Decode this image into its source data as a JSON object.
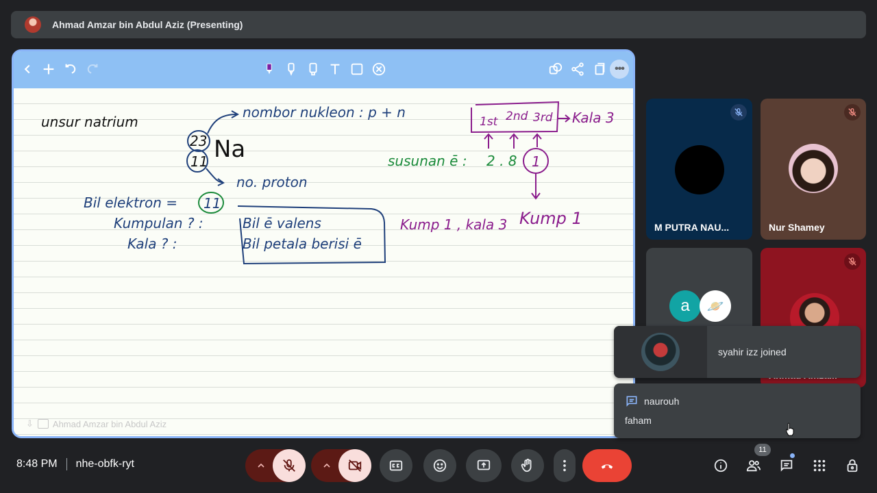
{
  "presenting_bar": {
    "title": "Ahmad Amzar bin Abdul Aziz (Presenting)"
  },
  "jamboard": {
    "toolbar_left": [
      "back-icon",
      "add-icon",
      "undo-icon",
      "redo-icon"
    ],
    "toolbar_center": [
      "pen-icon",
      "marker-icon",
      "highlighter-icon",
      "text-icon",
      "shape-icon",
      "eraser-icon"
    ],
    "toolbar_right": [
      "copy-icon",
      "share-icon",
      "pages-icon",
      "more-icon"
    ],
    "watermark": "Ahmad Amzar bin Abdul Aziz"
  },
  "notes": {
    "unsur": "unsur natrium",
    "mass_number": "23",
    "proton_number": "11",
    "symbol": "Na",
    "nukleon": "nombor nukleon : p + n",
    "no_proton": "no. proton",
    "bil_elektron": "Bil elektron =",
    "bil_elektron_val": "11",
    "kumpulan": "Kumpulan ? :",
    "kala": "Kala   ? :",
    "box_line1": "Bil ē valens",
    "box_line2": "Bil petala berisi ē",
    "susunan": "susunan ē :",
    "susunan_val": "2 . 8",
    "valence": "1",
    "shell1": "1st",
    "shell2": "2nd",
    "shell3": "3rd",
    "kala3": "Kala 3",
    "kump1": "Kump 1",
    "answer": "Kump 1 , kala 3"
  },
  "colors": {
    "blue_ink": "#1e3f7a",
    "green_ink": "#1a8a3a",
    "purple_ink": "#8a1c8c"
  },
  "participants": [
    {
      "name": "M PUTRA NAU...",
      "muted": true
    },
    {
      "name": "Nur Shamey",
      "muted": true
    },
    {
      "initial": "a"
    },
    {
      "name": "Ahmad Amza...",
      "muted": true
    }
  ],
  "toast_join": {
    "text": "syahir izz joined"
  },
  "toast_chat": {
    "sender": "naurouh",
    "message": "faham"
  },
  "bottom": {
    "time": "8:48 PM",
    "meeting_code": "nhe-obfk-ryt",
    "participant_count": "11"
  }
}
